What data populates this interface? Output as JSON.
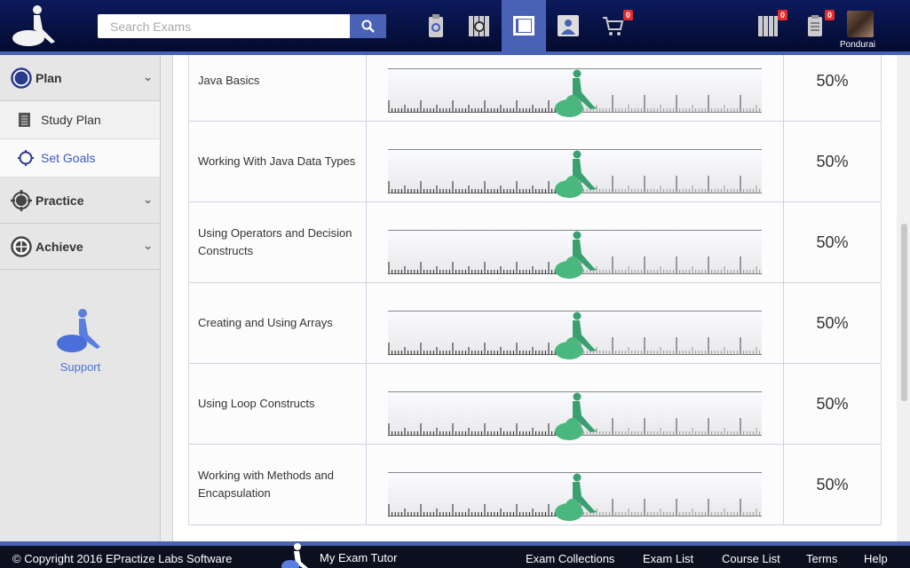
{
  "header": {
    "search_placeholder": "Search Exams",
    "cart_count": "0",
    "library_count": "0",
    "clipboard_count": "0",
    "username": "Pondurai",
    "icons": [
      "clipboard-search-icon",
      "library-search-icon",
      "book-icon",
      "profile-icon",
      "cart-icon"
    ]
  },
  "sidebar": {
    "plan": "Plan",
    "study_plan": "Study Plan",
    "set_goals": "Set Goals",
    "practice": "Practice",
    "achieve": "Achieve",
    "support": "Support"
  },
  "goals": [
    {
      "topic": "Java Basics",
      "progress": 50,
      "percent": "50%"
    },
    {
      "topic": "Working With Java Data Types",
      "progress": 50,
      "percent": "50%"
    },
    {
      "topic": "Using Operators and Decision Constructs",
      "progress": 50,
      "percent": "50%"
    },
    {
      "topic": "Creating and Using Arrays",
      "progress": 50,
      "percent": "50%"
    },
    {
      "topic": "Using Loop Constructs",
      "progress": 50,
      "percent": "50%"
    },
    {
      "topic": "Working with Methods and Encapsulation",
      "progress": 50,
      "percent": "50%"
    }
  ],
  "footer": {
    "copyright": "© Copyright 2016 EPractize Labs Software",
    "brand": "My Exam Tutor",
    "links": [
      "Exam Collections",
      "Exam List",
      "Course List",
      "Terms",
      "Help"
    ]
  },
  "colors": {
    "accent": "#4a62b5",
    "header": "#0c1a5c",
    "figure": "#3aa070",
    "active_link": "#3b5bc6"
  }
}
